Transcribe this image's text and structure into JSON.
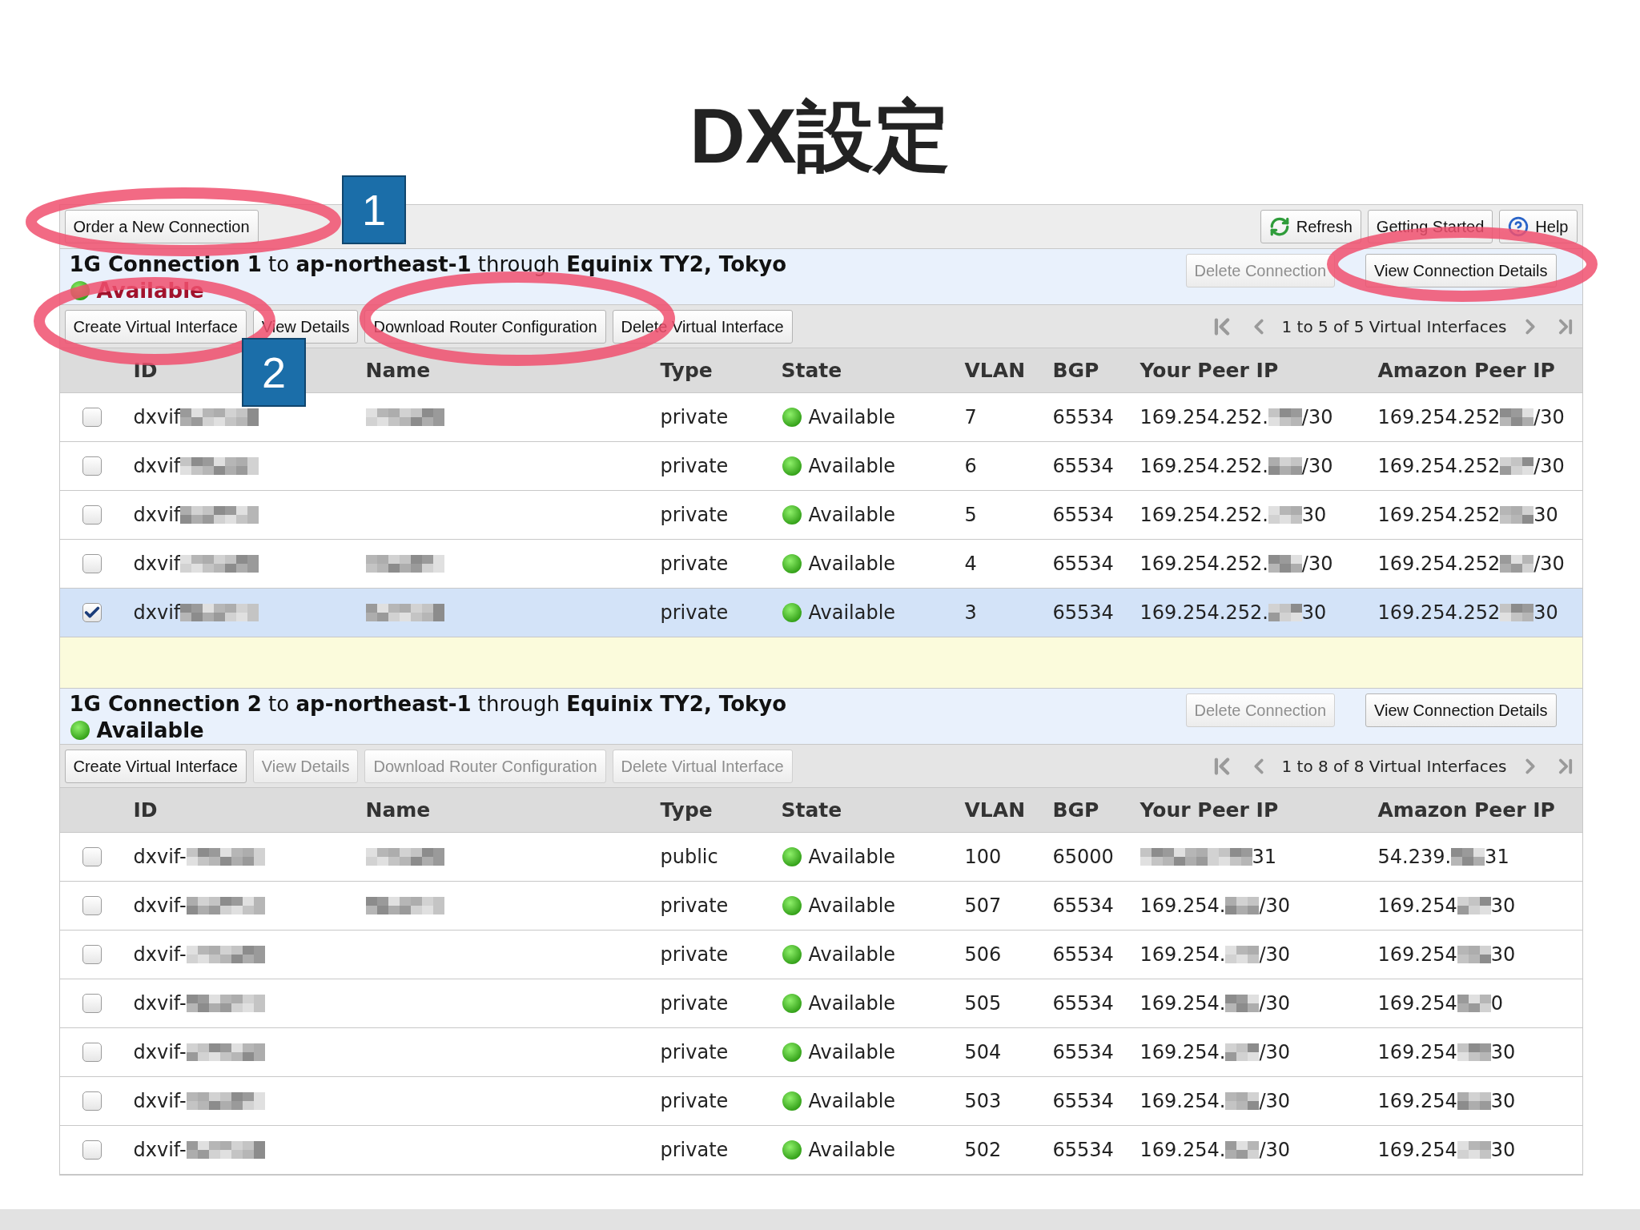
{
  "title": "DX設定",
  "toolbar": {
    "order_button": "Order a New Connection",
    "buttons": [
      {
        "kind": "refresh",
        "label": "Refresh"
      },
      {
        "kind": "plain",
        "label": "Getting Started"
      },
      {
        "kind": "help",
        "label": "Help"
      }
    ]
  },
  "connections": [
    {
      "title": "**1G Connection 1** to **ap-northeast-1** through **Equinix TY2, Tokyo**",
      "status": "Available",
      "selected": true,
      "header_buttons": [
        {
          "label": "Delete Connection",
          "disabled": true
        },
        {
          "label": "View Connection Details",
          "disabled": false
        }
      ],
      "actions": [
        {
          "label": "Create Virtual Interface",
          "disabled": false
        },
        {
          "label": "View Details",
          "disabled": false
        },
        {
          "label": "Download Router Configuration",
          "disabled": false
        },
        {
          "label": "Delete Virtual Interface",
          "disabled": false
        }
      ],
      "pager": "1 to 5 of 5 Virtual Interfaces",
      "columns": [
        "ID",
        "Name",
        "Type",
        "State",
        "VLAN",
        "BGP",
        "Your Peer IP",
        "Amazon Peer IP"
      ],
      "rows": [
        {
          "checked": false,
          "selected": false,
          "id": "dxvif",
          "name_hidden": true,
          "type": "private",
          "state": "Available",
          "vlan": "7",
          "bgp": "65534",
          "your_peer_ip": {
            "prefix": "169.254.252.",
            "suffix": "/30"
          },
          "amazon_peer_ip": {
            "prefix": "169.254.252",
            "suffix": "/30"
          }
        },
        {
          "checked": false,
          "selected": false,
          "id": "dxvif",
          "name_hidden": false,
          "type": "private",
          "state": "Available",
          "vlan": "6",
          "bgp": "65534",
          "your_peer_ip": {
            "prefix": "169.254.252.",
            "suffix": "/30"
          },
          "amazon_peer_ip": {
            "prefix": "169.254.252",
            "suffix": "/30"
          }
        },
        {
          "checked": false,
          "selected": false,
          "id": "dxvif",
          "name_hidden": false,
          "type": "private",
          "state": "Available",
          "vlan": "5",
          "bgp": "65534",
          "your_peer_ip": {
            "prefix": "169.254.252.",
            "suffix": "30"
          },
          "amazon_peer_ip": {
            "prefix": "169.254.252",
            "suffix": "30"
          }
        },
        {
          "checked": false,
          "selected": false,
          "id": "dxvif",
          "name_hidden": true,
          "type": "private",
          "state": "Available",
          "vlan": "4",
          "bgp": "65534",
          "your_peer_ip": {
            "prefix": "169.254.252.",
            "suffix": "/30"
          },
          "amazon_peer_ip": {
            "prefix": "169.254.252",
            "suffix": "/30"
          }
        },
        {
          "checked": true,
          "selected": true,
          "id": "dxvif",
          "name_hidden": true,
          "type": "private",
          "state": "Available",
          "vlan": "3",
          "bgp": "65534",
          "your_peer_ip": {
            "prefix": "169.254.252.",
            "suffix": "30"
          },
          "amazon_peer_ip": {
            "prefix": "169.254.252",
            "suffix": "30"
          }
        }
      ]
    },
    {
      "title": "**1G Connection 2** to **ap-northeast-1** through **Equinix TY2, Tokyo**",
      "status": "Available",
      "selected": false,
      "header_buttons": [
        {
          "label": "Delete Connection",
          "disabled": true
        },
        {
          "label": "View Connection Details",
          "disabled": false
        }
      ],
      "actions": [
        {
          "label": "Create Virtual Interface",
          "disabled": false
        },
        {
          "label": "View Details",
          "disabled": true
        },
        {
          "label": "Download Router Configuration",
          "disabled": true
        },
        {
          "label": "Delete Virtual Interface",
          "disabled": true
        }
      ],
      "pager": "1 to 8 of 8 Virtual Interfaces",
      "columns": [
        "ID",
        "Name",
        "Type",
        "State",
        "VLAN",
        "BGP",
        "Your Peer IP",
        "Amazon Peer IP"
      ],
      "rows": [
        {
          "checked": false,
          "selected": false,
          "id": "dxvif-",
          "name_hidden": true,
          "type": "public",
          "state": "Available",
          "vlan": "100",
          "bgp": "65000",
          "your_peer_ip": {
            "suffix": "31"
          },
          "amazon_peer_ip": {
            "prefix": "54.239.",
            "suffix": "31"
          }
        },
        {
          "checked": false,
          "selected": false,
          "id": "dxvif-",
          "name_hidden": true,
          "type": "private",
          "state": "Available",
          "vlan": "507",
          "bgp": "65534",
          "your_peer_ip": {
            "prefix": "169.254.",
            "suffix": "/30"
          },
          "amazon_peer_ip": {
            "prefix": "169.254",
            "suffix": "30"
          }
        },
        {
          "checked": false,
          "selected": false,
          "id": "dxvif-",
          "name_hidden": false,
          "type": "private",
          "state": "Available",
          "vlan": "506",
          "bgp": "65534",
          "your_peer_ip": {
            "prefix": "169.254.",
            "suffix": "/30"
          },
          "amazon_peer_ip": {
            "prefix": "169.254",
            "suffix": "30"
          }
        },
        {
          "checked": false,
          "selected": false,
          "id": "dxvif-",
          "name_hidden": false,
          "type": "private",
          "state": "Available",
          "vlan": "505",
          "bgp": "65534",
          "your_peer_ip": {
            "prefix": "169.254.",
            "suffix": "/30"
          },
          "amazon_peer_ip": {
            "prefix": "169.254",
            "suffix": "0"
          }
        },
        {
          "checked": false,
          "selected": false,
          "id": "dxvif-",
          "name_hidden": false,
          "type": "private",
          "state": "Available",
          "vlan": "504",
          "bgp": "65534",
          "your_peer_ip": {
            "prefix": "169.254.",
            "suffix": "/30"
          },
          "amazon_peer_ip": {
            "prefix": "169.254",
            "suffix": "30"
          }
        },
        {
          "checked": false,
          "selected": false,
          "id": "dxvif-",
          "name_hidden": false,
          "type": "private",
          "state": "Available",
          "vlan": "503",
          "bgp": "65534",
          "your_peer_ip": {
            "prefix": "169.254.",
            "suffix": "/30"
          },
          "amazon_peer_ip": {
            "prefix": "169.254",
            "suffix": "30"
          }
        },
        {
          "checked": false,
          "selected": false,
          "id": "dxvif-",
          "name_hidden": false,
          "type": "private",
          "state": "Available",
          "vlan": "502",
          "bgp": "65534",
          "your_peer_ip": {
            "prefix": "169.254.",
            "suffix": "/30"
          },
          "amazon_peer_ip": {
            "prefix": "169.254",
            "suffix": "30"
          }
        }
      ]
    }
  ],
  "annotations": [
    {
      "label": "1"
    },
    {
      "label": "2"
    }
  ]
}
